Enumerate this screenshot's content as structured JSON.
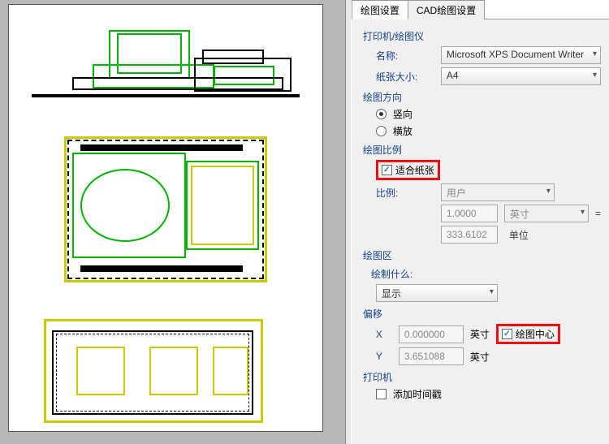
{
  "tabs": {
    "plot": "绘图设置",
    "cad": "CAD绘图设置"
  },
  "printer": {
    "group": "打印机/绘图仪",
    "name_label": "名称:",
    "name_value": "Microsoft XPS Document Writer",
    "paper_label": "纸张大小:",
    "paper_value": "A4"
  },
  "orientation": {
    "group": "绘图方向",
    "portrait": "竖向",
    "landscape": "横放",
    "selected": "portrait"
  },
  "scale": {
    "group": "绘图比例",
    "fit_label": "适合纸张",
    "fit_checked": true,
    "ratio_label": "比例:",
    "ratio_value": "用户",
    "num_value": "1.0000",
    "num_unit": "英寸",
    "eq": "=",
    "den_value": "333.6102",
    "den_unit": "单位"
  },
  "area": {
    "group": "绘图区",
    "what_label": "绘制什么:",
    "what_value": "显示"
  },
  "offset": {
    "group": "偏移",
    "x_label": "X",
    "x_value": "0.000000",
    "x_unit": "英寸",
    "center_label": "绘图中心",
    "center_checked": true,
    "y_label": "Y",
    "y_value": "3.651088",
    "y_unit": "英寸"
  },
  "stamp": {
    "group": "打印机",
    "ts_label": "添加时间戳",
    "ts_checked": false
  }
}
